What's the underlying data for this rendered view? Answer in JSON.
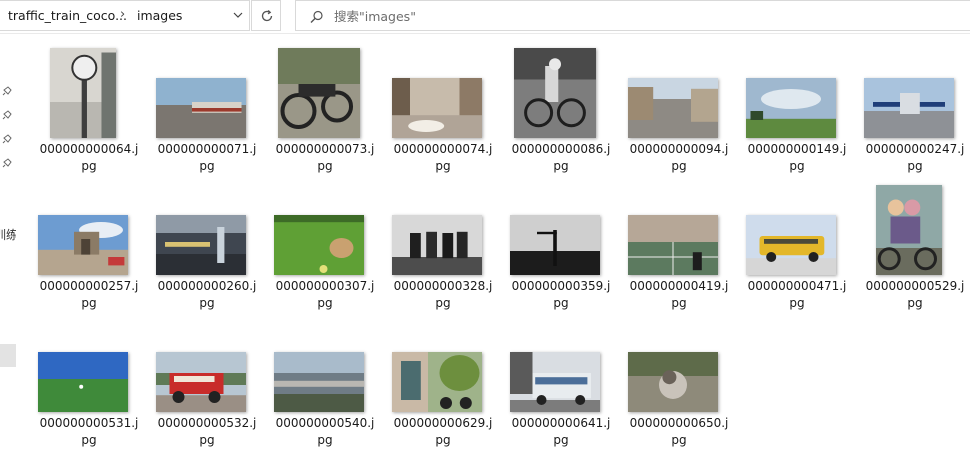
{
  "address_bar": {
    "crumbs": [
      "traffic_train_coco...",
      "images"
    ]
  },
  "search": {
    "placeholder": "搜索\"images\""
  },
  "nav_pane": {
    "partial_label": "训练"
  },
  "files": [
    {
      "name_line1": "000000000064.j",
      "name_line2": "pg",
      "thumb": "clock-tower",
      "shape": "portrait"
    },
    {
      "name_line1": "000000000071.j",
      "name_line2": "pg",
      "thumb": "train-station",
      "shape": "landscape"
    },
    {
      "name_line1": "000000000073.j",
      "name_line2": "pg",
      "thumb": "motorcycles",
      "shape": "square"
    },
    {
      "name_line1": "000000000074.j",
      "name_line2": "pg",
      "thumb": "dog-street",
      "shape": "landscape"
    },
    {
      "name_line1": "000000000086.j",
      "name_line2": "pg",
      "thumb": "man-bicycle",
      "shape": "square"
    },
    {
      "name_line1": "000000000094.j",
      "name_line2": "pg",
      "thumb": "city-street",
      "shape": "landscape"
    },
    {
      "name_line1": "000000000149.j",
      "name_line2": "pg",
      "thumb": "field-sky",
      "shape": "landscape"
    },
    {
      "name_line1": "000000000247.j",
      "name_line2": "pg",
      "thumb": "airplane",
      "shape": "landscape"
    },
    {
      "name_line1": "000000000257.j",
      "name_line2": "pg",
      "thumb": "monument-plaza",
      "shape": "landscape"
    },
    {
      "name_line1": "000000000260.j",
      "name_line2": "pg",
      "thumb": "terminal-interior",
      "shape": "landscape"
    },
    {
      "name_line1": "000000000307.j",
      "name_line2": "pg",
      "thumb": "dog-grass",
      "shape": "landscape"
    },
    {
      "name_line1": "000000000328.j",
      "name_line2": "pg",
      "thumb": "people-bench",
      "shape": "landscape"
    },
    {
      "name_line1": "000000000359.j",
      "name_line2": "pg",
      "thumb": "traffic-light-silhouette",
      "shape": "landscape"
    },
    {
      "name_line1": "000000000419.j",
      "name_line2": "pg",
      "thumb": "tennis-court",
      "shape": "landscape"
    },
    {
      "name_line1": "000000000471.j",
      "name_line2": "pg",
      "thumb": "yellow-bus",
      "shape": "landscape"
    },
    {
      "name_line1": "000000000529.j",
      "name_line2": "pg",
      "thumb": "motorbike-riders",
      "shape": "portrait"
    },
    {
      "name_line1": "000000000531.j",
      "name_line2": "pg",
      "thumb": "baseball-field",
      "shape": "landscape"
    },
    {
      "name_line1": "000000000532.j",
      "name_line2": "pg",
      "thumb": "red-truck",
      "shape": "landscape"
    },
    {
      "name_line1": "000000000540.j",
      "name_line2": "pg",
      "thumb": "airport-aerial",
      "shape": "landscape"
    },
    {
      "name_line1": "000000000629.j",
      "name_line2": "pg",
      "thumb": "mural-motorcycle",
      "shape": "landscape"
    },
    {
      "name_line1": "000000000641.j",
      "name_line2": "pg",
      "thumb": "city-bus",
      "shape": "landscape"
    },
    {
      "name_line1": "000000000650.j",
      "name_line2": "pg",
      "thumb": "cat-car",
      "shape": "landscape"
    }
  ]
}
